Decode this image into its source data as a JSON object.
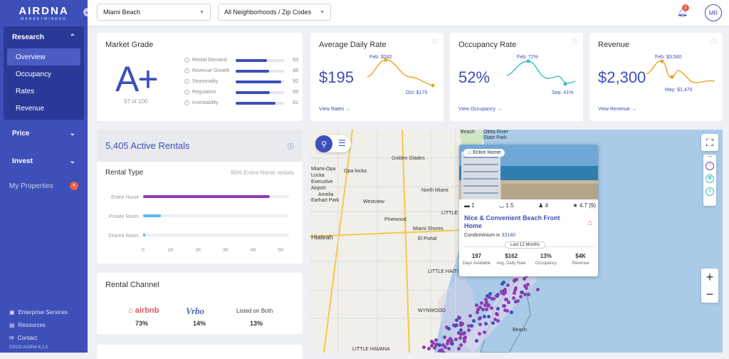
{
  "brand": {
    "name": "AIRDNA",
    "tagline": "MARKETMINDER"
  },
  "sidebar": {
    "research": "Research",
    "subitems": [
      "Overview",
      "Occupancy",
      "Rates",
      "Revenue"
    ],
    "price": "Price",
    "invest": "Invest",
    "my_properties": "My Properties",
    "my_properties_count": "6",
    "footer": [
      "Enterprise Services",
      "Resources",
      "Contact"
    ],
    "copyright": "©2020 AirDNA 8.1.3"
  },
  "topbar": {
    "city": "Miami Beach",
    "neighborhood": "All Neighborhoods / Zip Codes",
    "notifications": "2",
    "avatar": "MR"
  },
  "market_grade": {
    "title": "Market Grade",
    "grade": "A+",
    "score": "97 of 100",
    "metrics": [
      {
        "name": "Rental Demand",
        "value": "63",
        "pct": 0.63
      },
      {
        "name": "Revenue Growth",
        "value": "68",
        "pct": 0.68
      },
      {
        "name": "Seasonality",
        "value": "92",
        "pct": 0.92
      },
      {
        "name": "Regulation",
        "value": "69",
        "pct": 0.69
      },
      {
        "name": "Investability",
        "value": "81",
        "pct": 0.81
      }
    ]
  },
  "adr": {
    "title": "Average Daily Rate",
    "value": "$195",
    "high": "Feb: $242",
    "low": "Oct: $170",
    "link": "View Rates →",
    "color": "#e9a325"
  },
  "occ": {
    "title": "Occupancy Rate",
    "value": "52%",
    "high": "Feb: 72%",
    "low": "Sep: 41%",
    "link": "View Occupancy →",
    "color": "#3bbcc2"
  },
  "rev": {
    "title": "Revenue",
    "value": "$2,300",
    "high": "Feb: $3,560",
    "low": "May: $1,470",
    "link": "View Revenue →",
    "color": "#e9a325"
  },
  "rentals": {
    "title": "5,405 Active Rentals"
  },
  "rental_type": {
    "title": "Rental Type",
    "subtitle": "85% Entire Home rentals",
    "rows": [
      {
        "name": "Entire Home",
        "value": 4600,
        "color": "#8e3cb0"
      },
      {
        "name": "Private Room",
        "value": 650,
        "color": "#5fb4f0"
      },
      {
        "name": "Shared Room",
        "value": 40,
        "color": "#3bbcc2"
      }
    ],
    "ticks": [
      "0",
      "1K",
      "2K",
      "3K",
      "4K",
      "5K"
    ],
    "max": 5300
  },
  "channel": {
    "title": "Rental Channel",
    "airbnb": "airbnb",
    "vrbo": "Vrbo",
    "both": "Listed on Both",
    "airbnb_pct": "73%",
    "vrbo_pct": "14%",
    "both_pct": "13%"
  },
  "map_labels": [
    "Golden Glades",
    "Opa-locka",
    "North Miami",
    "Westview",
    "Pinewood",
    "Miami Shores",
    "El Portal",
    "Hialeah",
    "LITTLE HAITI",
    "WYNWOOD",
    "Oleta River",
    "State Park",
    "LITTLE RIVER",
    "Miami-Opa",
    "Locka",
    "Executive",
    "Airport",
    "Amelia",
    "Earhart Park",
    "Beach",
    "Beach",
    "LITTLE HAVANA"
  ],
  "popup": {
    "type": "Entire Home",
    "beds": "1",
    "baths": "1.5",
    "guests": "4",
    "rating": "4.7 (9)",
    "title": "Nice & Convenient Beach Front Home",
    "subtype": "Condominium in",
    "zip": "33140",
    "period": "Last 12 Months",
    "stats": [
      {
        "value": "197",
        "label": "Days Available"
      },
      {
        "value": "$162",
        "label": "Avg. Daily Rate"
      },
      {
        "value": "13%",
        "label": "Occupancy"
      },
      {
        "value": "$4K",
        "label": "Revenue"
      }
    ]
  }
}
